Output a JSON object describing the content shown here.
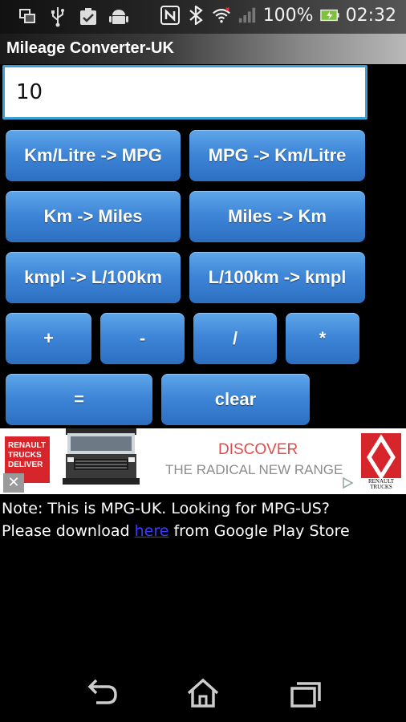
{
  "status_bar": {
    "icons_left": [
      "screenshot-icon",
      "usb-icon",
      "clipboard-check-icon",
      "android-debug-icon"
    ],
    "icons_right": [
      "nfc-icon",
      "bluetooth-icon",
      "wifi-icon",
      "signal-icon",
      "battery-icon"
    ],
    "battery": "100%",
    "time": "02:32"
  },
  "app": {
    "title": "Mileage Converter-UK"
  },
  "input": {
    "value": "10"
  },
  "buttons": {
    "kml_to_mpg": "Km/Litre -> MPG",
    "mpg_to_kml": "MPG -> Km/Litre",
    "km_to_miles": "Km -> Miles",
    "miles_to_km": "Miles -> Km",
    "kmpl_to_l100": "kmpl -> L/100km",
    "l100_to_kmpl": "L/100km -> kmpl",
    "plus": "+",
    "minus": "-",
    "divide": "/",
    "multiply": "*",
    "equals": "=",
    "clear": "clear"
  },
  "ad": {
    "brand_left": "RENAULT TRUCKS DELIVER",
    "headline": "DISCOVER",
    "tagline": "THE RADICAL NEW RANGE",
    "brand_right": "RENAULT TRUCKS",
    "close": "✕"
  },
  "note": {
    "line1": "Note: This is MPG-UK. Looking for MPG-US?",
    "line2_pre": "Please download ",
    "link": "here",
    "line2_post": " from Google Play Store"
  },
  "colors": {
    "button": "#3f86d8",
    "input_border": "#3aa0d8",
    "link": "#3b3bff",
    "ad_red": "#d7262b"
  }
}
